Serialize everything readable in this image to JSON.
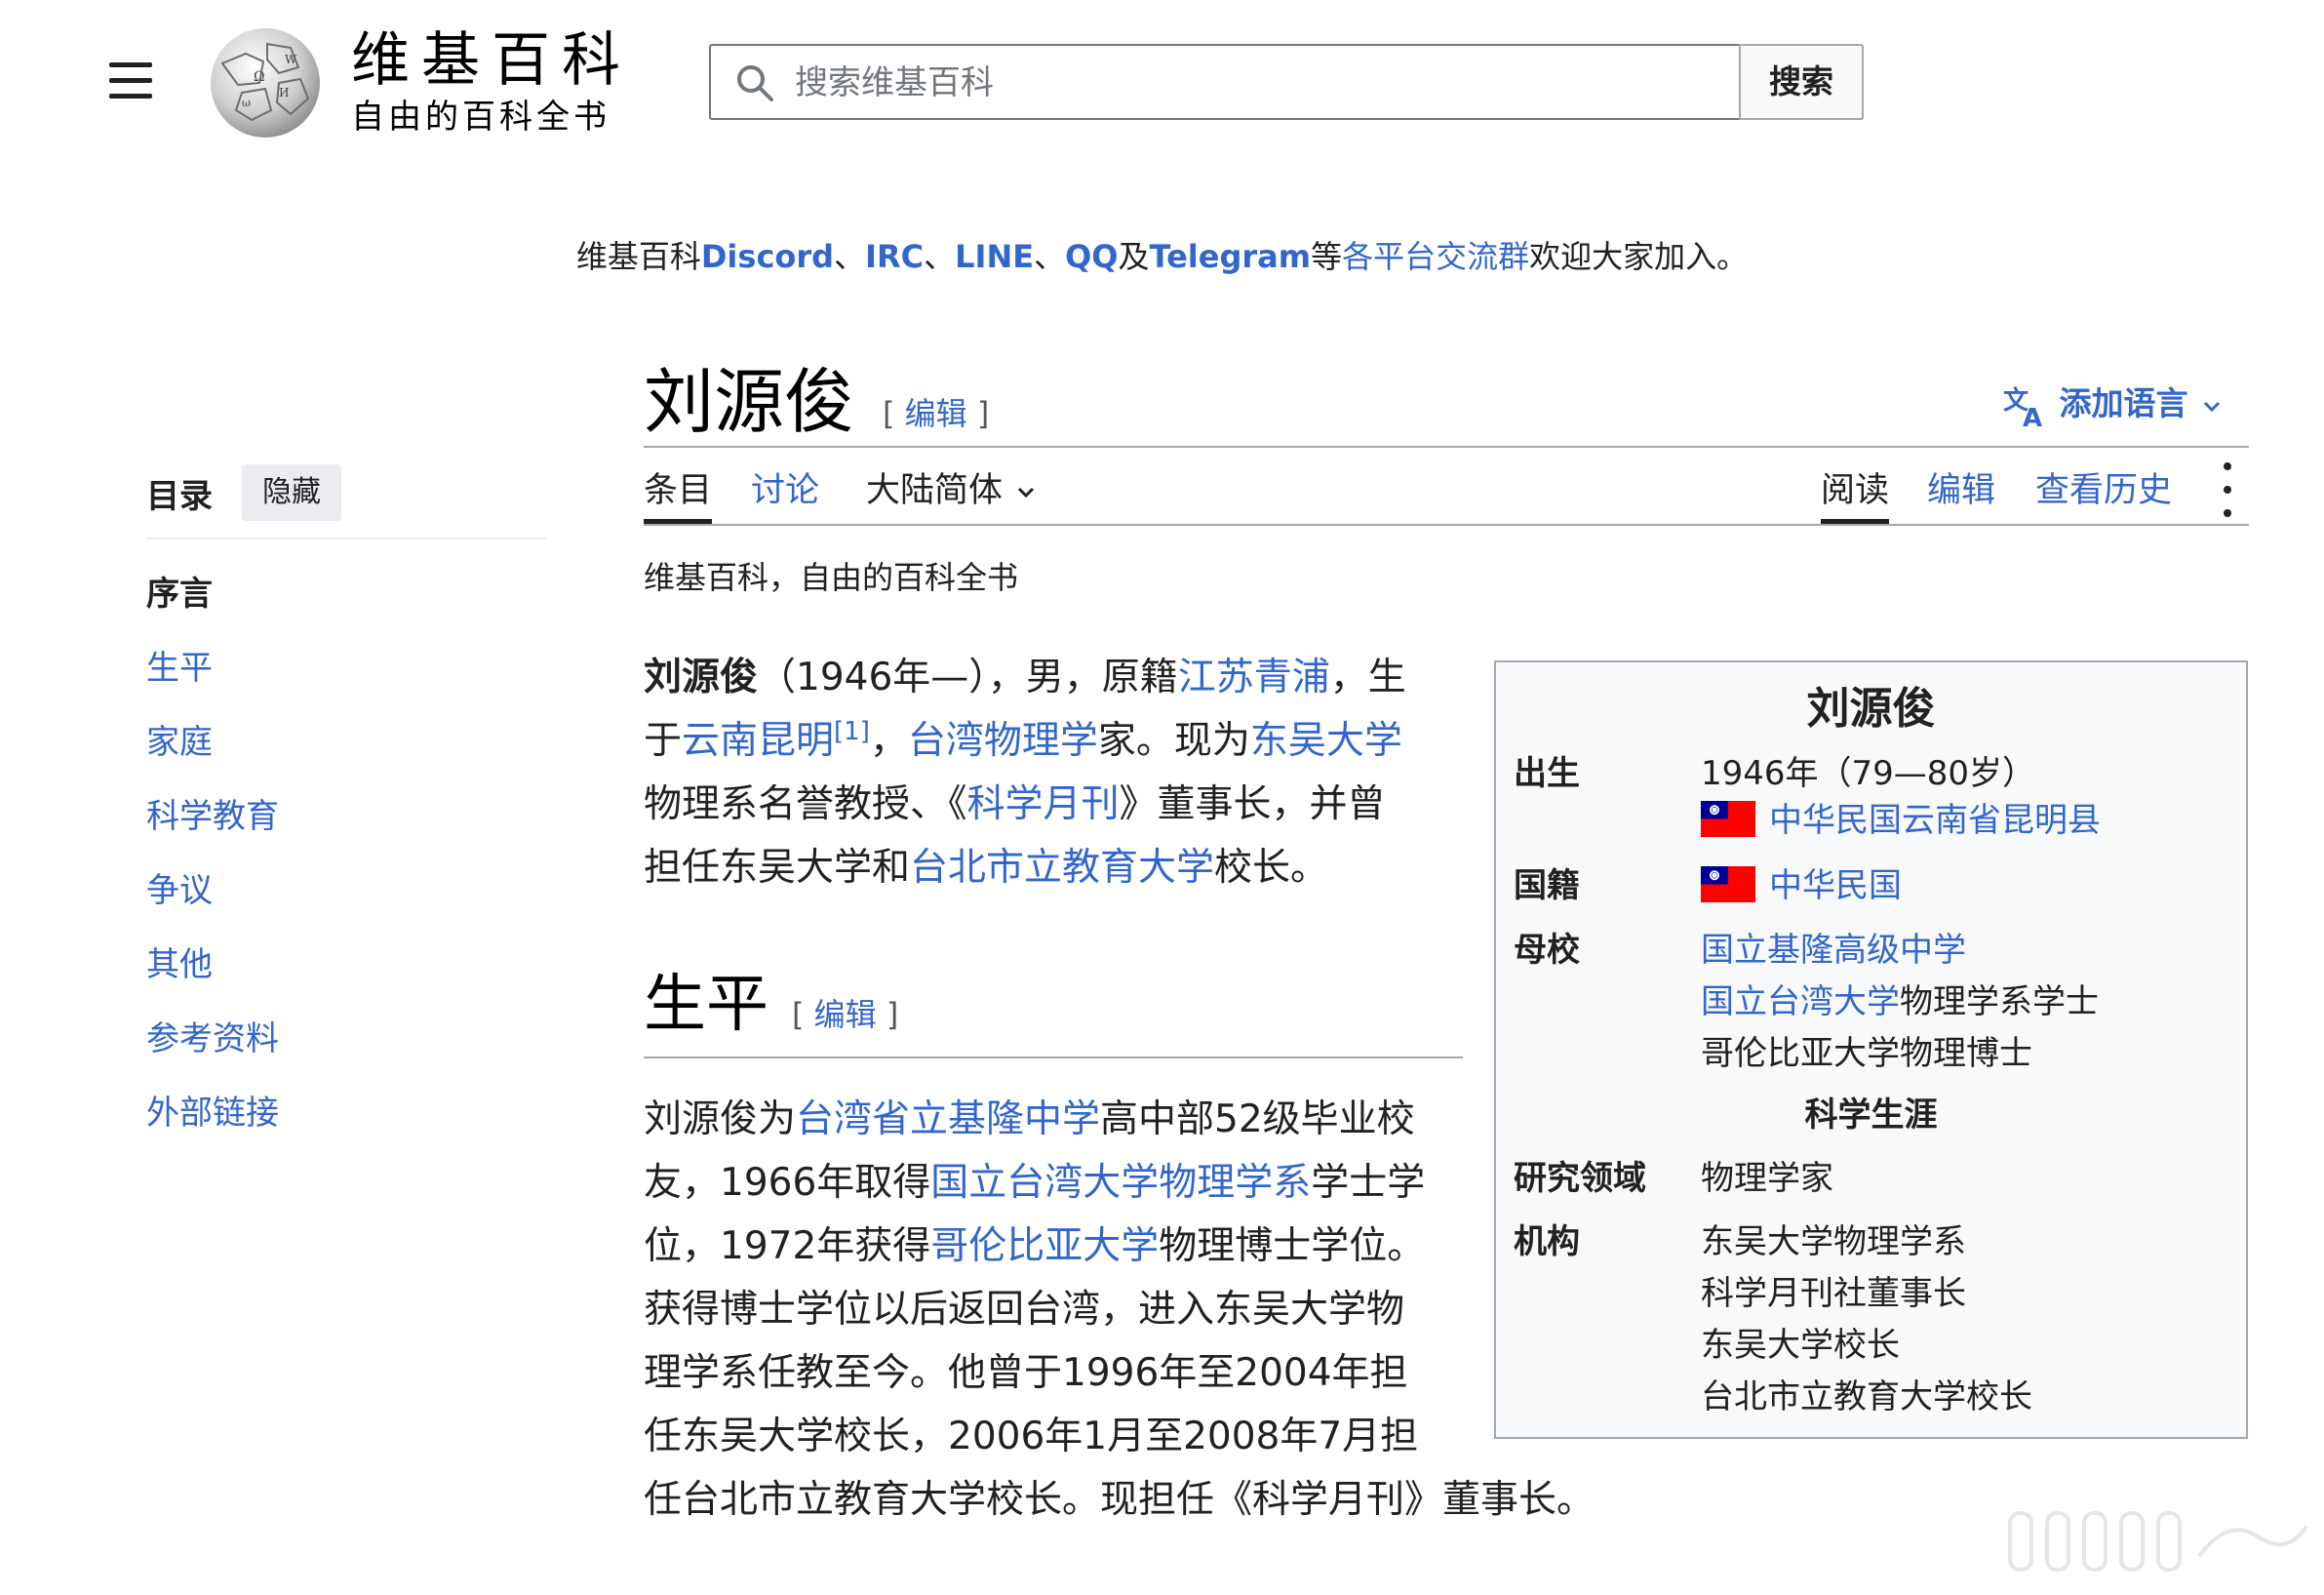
{
  "header": {
    "wordmark": "维基百科",
    "tagline": "自由的百科全书",
    "search": {
      "placeholder": "搜索维基百科",
      "button": "搜索"
    }
  },
  "site_notice": {
    "prefix": "维基百科",
    "discord": "Discord",
    "sep1": "、",
    "irc": "IRC",
    "sep2": "、",
    "line": "LINE",
    "sep3": "、",
    "qq": "QQ",
    "and": "及",
    "telegram": "Telegram",
    "etc": "等",
    "groups_link": "各平台交流群",
    "suffix": "欢迎大家加入。"
  },
  "toc": {
    "title": "目录",
    "hide": "隐藏",
    "items": [
      "序言",
      "生平",
      "家庭",
      "科学教育",
      "争议",
      "其他",
      "参考资料",
      "外部链接"
    ]
  },
  "page": {
    "title": "刘源俊",
    "edit_open": "[",
    "edit_label": "编辑",
    "edit_close": "]",
    "add_languages": "添加语言"
  },
  "tabs": {
    "article": "条目",
    "talk": "讨论",
    "variant": "大陆简体",
    "read": "阅读",
    "edit": "编辑",
    "history": "查看历史"
  },
  "site_sub": "维基百科，自由的百科全书",
  "lead": {
    "name": "刘源俊",
    "t1": "（1946年—），男，原籍",
    "link1": "江苏青浦",
    "t2": "，生",
    "t3": "于",
    "link2": "云南昆明",
    "ref": "[1]",
    "t4": "，",
    "link3": "台湾物理学",
    "t5": "家。现为",
    "link4": "东吴大学",
    "t6": "物理系名誉教授、《",
    "link5": "科学月刊",
    "t7": "》董事长，并曾",
    "t8": "担任东吴大学和",
    "link6": "台北市立教育大学",
    "t9": "校长。"
  },
  "section_life": {
    "heading": "生平",
    "edit_label": "编辑",
    "t1": "刘源俊为",
    "link1": "台湾省立基隆中学",
    "t2": "高中部52级毕业校",
    "t3": "友，1966年取得",
    "link2": "国立台湾大学物理学系",
    "t4": "学士学",
    "t5": "位，1972年获得",
    "link3": "哥伦比亚大学",
    "t6": "物理博士学位。",
    "t7": "获得博士学位以后返回台湾，进入东吴大学物",
    "t8": "理学系任教至今。他曾于1996年至2004年担",
    "t9": "任东吴大学校长，2006年1月至2008年7月担",
    "t10": "任台北市立教育大学校长。现担任《科学月刊》董事长。"
  },
  "infobox": {
    "title": "刘源俊",
    "born_label": "出生",
    "born_value": "1946年（79—80岁）",
    "born_place": "中华民国云南省昆明县",
    "nationality_label": "国籍",
    "nationality_value": "中华民国",
    "alma_label": "母校",
    "alma_1": "国立基隆高级中学",
    "alma_2_link": "国立台湾大学",
    "alma_2_rest": "物理学系学士",
    "alma_3": "哥伦比亚大学物理博士",
    "section": "科学生涯",
    "field_label": "研究领域",
    "field_value": "物理学家",
    "inst_label": "机构",
    "inst_1": "东吴大学物理学系",
    "inst_2": "科学月刊社董事长",
    "inst_3": "东吴大学校长",
    "inst_4": "台北市立教育大学校长"
  },
  "colors": {
    "link": "#3366cc",
    "text": "#202122",
    "border": "#a2a9b1",
    "infobox_bg": "#f8f9fa"
  }
}
